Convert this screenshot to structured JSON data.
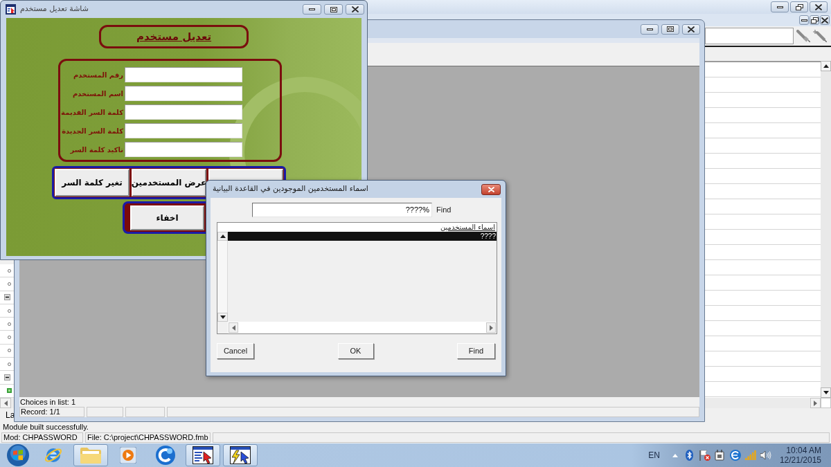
{
  "app_window": {
    "navigator": {
      "rows": [
        {
          "kind": "item"
        },
        {
          "kind": "item"
        },
        {
          "kind": "group",
          "expanded": true
        },
        {
          "kind": "item"
        },
        {
          "kind": "item"
        },
        {
          "kind": "item"
        },
        {
          "kind": "item"
        },
        {
          "kind": "item"
        },
        {
          "kind": "group",
          "expanded": true
        },
        {
          "kind": "module"
        }
      ]
    },
    "cut_label": "La",
    "message": "Module built successfully.",
    "status_bar": {
      "module": "Mod: CHPASSWORD",
      "file": "File: C:\\project\\CHPASSWORD.fmb"
    }
  },
  "runtime_window": {
    "status_message": "Choices in list: 1",
    "record": "Record: 1/1"
  },
  "form_window": {
    "title": "شاشة تعديل مستخدم",
    "heading": "تعديل مستخدم",
    "fields": [
      {
        "label": "رقم المستخدم"
      },
      {
        "label": "اسم المستخدم"
      },
      {
        "label": "كلمة السر القديمة"
      },
      {
        "label": "كلمة السر الجديدة"
      },
      {
        "label": "تاكيد كلمة السر"
      }
    ],
    "buttons": [
      "عرض المستخدمين",
      "تغير كلمة السر"
    ],
    "hide_button": "اخفاء"
  },
  "dialog": {
    "title": "اسماء المستخدمين الموجودين في القاعدة البيانية",
    "find": {
      "value": "????%",
      "label": "Find"
    },
    "list": {
      "column": "اسماء المستخدمين",
      "rows": [
        {
          "text": "????",
          "selected": true
        }
      ]
    },
    "buttons": {
      "cancel": "Cancel",
      "ok": "OK",
      "find": "Find"
    }
  },
  "taskbar": {
    "apps": [
      {
        "kind": "browser",
        "open": false
      },
      {
        "kind": "folder",
        "open": true
      },
      {
        "kind": "media",
        "open": false
      },
      {
        "kind": "circle-app",
        "open": false
      },
      {
        "kind": "designer",
        "open": true
      },
      {
        "kind": "runner",
        "open": true
      }
    ],
    "tray": {
      "language": "EN",
      "time": "10:04 AM",
      "date": "12/21/2015"
    }
  }
}
